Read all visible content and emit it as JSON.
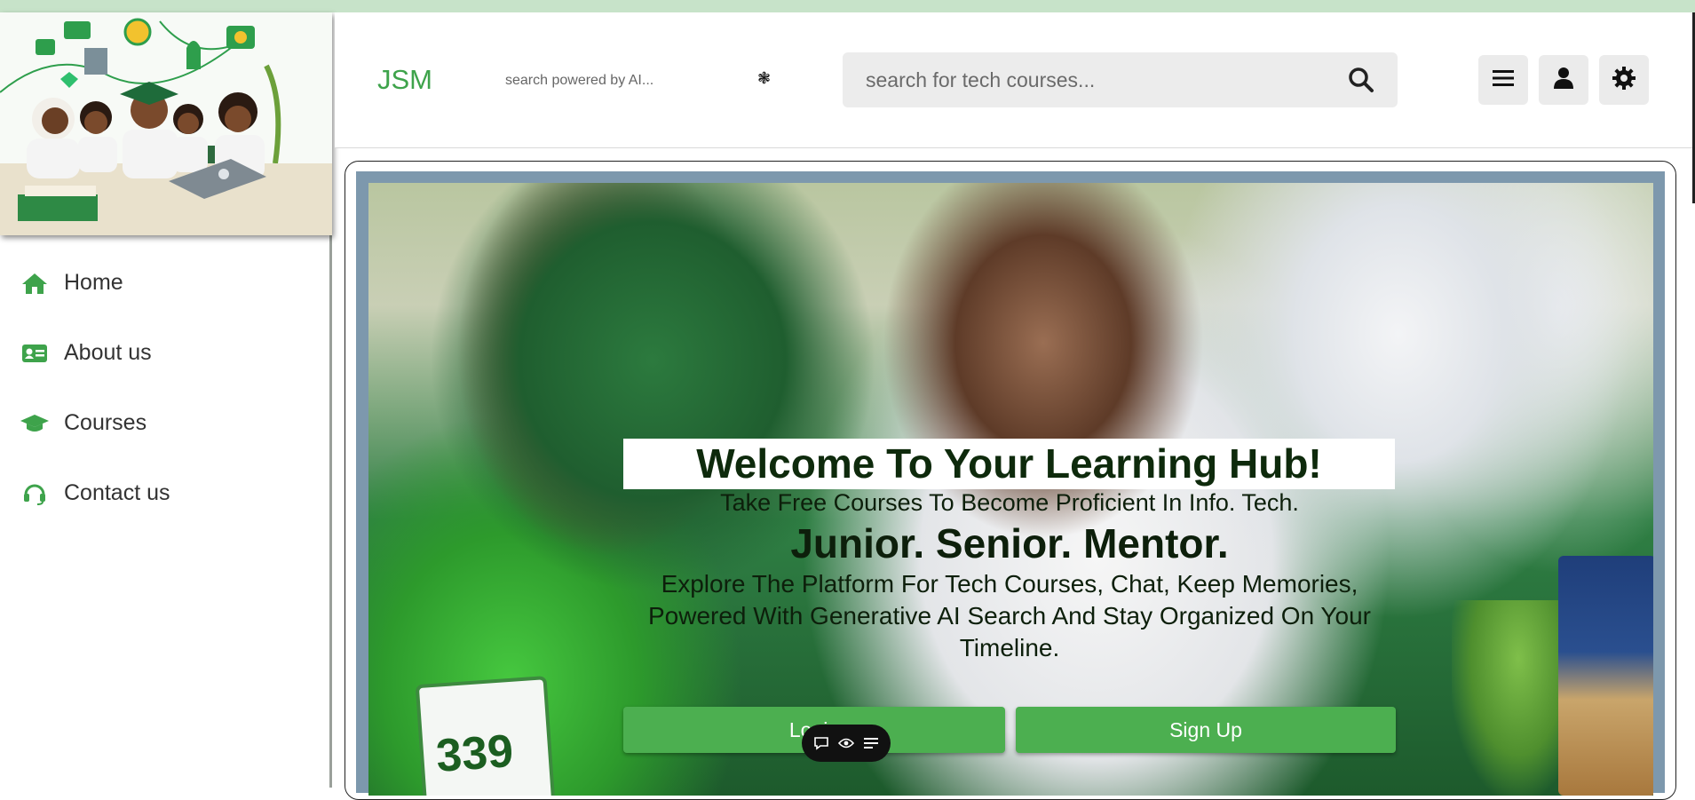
{
  "colors": {
    "brand_green": "#3ea34b",
    "button_green": "#4caf50",
    "top_strip": "#c7e3c9",
    "search_bg": "#ececec",
    "hero_text": "#0e2a0c"
  },
  "sidebar": {
    "thumbnail_icon": "students-learning-illustration",
    "items": [
      {
        "label": "Home",
        "icon": "home-icon"
      },
      {
        "label": "About us",
        "icon": "id-card-icon"
      },
      {
        "label": "Courses",
        "icon": "graduation-cap-icon"
      },
      {
        "label": "Contact us",
        "icon": "headset-icon"
      }
    ]
  },
  "header": {
    "brand": "JSM",
    "ai_hint": "search powered by AI...",
    "ai_spark": "❃",
    "search_placeholder": "search for tech courses...",
    "buttons": [
      "menu-icon",
      "user-icon",
      "gear-icon"
    ]
  },
  "hero": {
    "title": "Welcome To Your Learning Hub!",
    "subtitle": "Take Free Courses To Become Proficient In Info. Tech.",
    "tagline": "Junior. Senior. Mentor.",
    "description": "Explore The Platform For Tech Courses, Chat, Keep Memories, Powered With Generative AI Search And Stay Organized On Your Timeline.",
    "photo_screen_number": "339",
    "login_label": "Login",
    "signup_label": "Sign Up"
  },
  "floating_toolbar": {
    "icons": [
      "chat-bubble-icon",
      "eye-icon",
      "list-icon"
    ]
  }
}
